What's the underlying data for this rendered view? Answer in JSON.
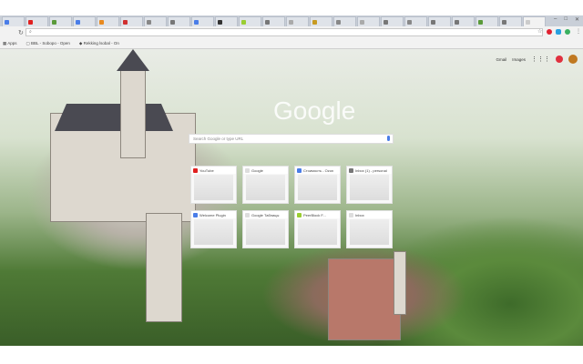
{
  "tabs": [
    {
      "color": "#4a7de8"
    },
    {
      "color": "#e02020"
    },
    {
      "color": "#5a9a3a"
    },
    {
      "color": "#4a7de8"
    },
    {
      "color": "#e88a20"
    },
    {
      "color": "#d03030"
    },
    {
      "color": "#888888"
    },
    {
      "color": "#777777"
    },
    {
      "color": "#4a7de8"
    },
    {
      "color": "#333333"
    },
    {
      "color": "#9acd32"
    },
    {
      "color": "#777777"
    },
    {
      "color": "#aaaaaa"
    },
    {
      "color": "#c79a20"
    },
    {
      "color": "#888888"
    },
    {
      "color": "#aaaaaa"
    },
    {
      "color": "#777777"
    },
    {
      "color": "#888888"
    },
    {
      "color": "#777777"
    },
    {
      "color": "#777777"
    },
    {
      "color": "#5a9a3a"
    },
    {
      "color": "#777777"
    },
    {
      "color": "#cccccc",
      "active": true
    }
  ],
  "window_controls": [
    "–",
    "□",
    "✕"
  ],
  "omnibox": {
    "value": ""
  },
  "bookmarks": {
    "apps": "Apps",
    "items": [
      "BBL - Sobopo - Open",
      "Rekking lsobal - On"
    ]
  },
  "ntp": {
    "gmail": "Gmail",
    "images": "Images",
    "logo": "Google",
    "search_placeholder": "Search Google or type URL",
    "tiles": [
      {
        "title": "YouTube",
        "color": "#e02020"
      },
      {
        "title": "Google",
        "color": "#dddddd"
      },
      {
        "title": "Стоимость - Ozon",
        "color": "#4a7de8"
      },
      {
        "title": "Inbox (1) - personal",
        "color": "#777777"
      },
      {
        "title": "Welcome Plugin",
        "color": "#4a7de8"
      },
      {
        "title": "Google Таблицы",
        "color": "#dddddd"
      },
      {
        "title": "PeerBlock F...",
        "color": "#9acd32"
      },
      {
        "title": "Inbox",
        "color": "#dddddd"
      }
    ]
  }
}
